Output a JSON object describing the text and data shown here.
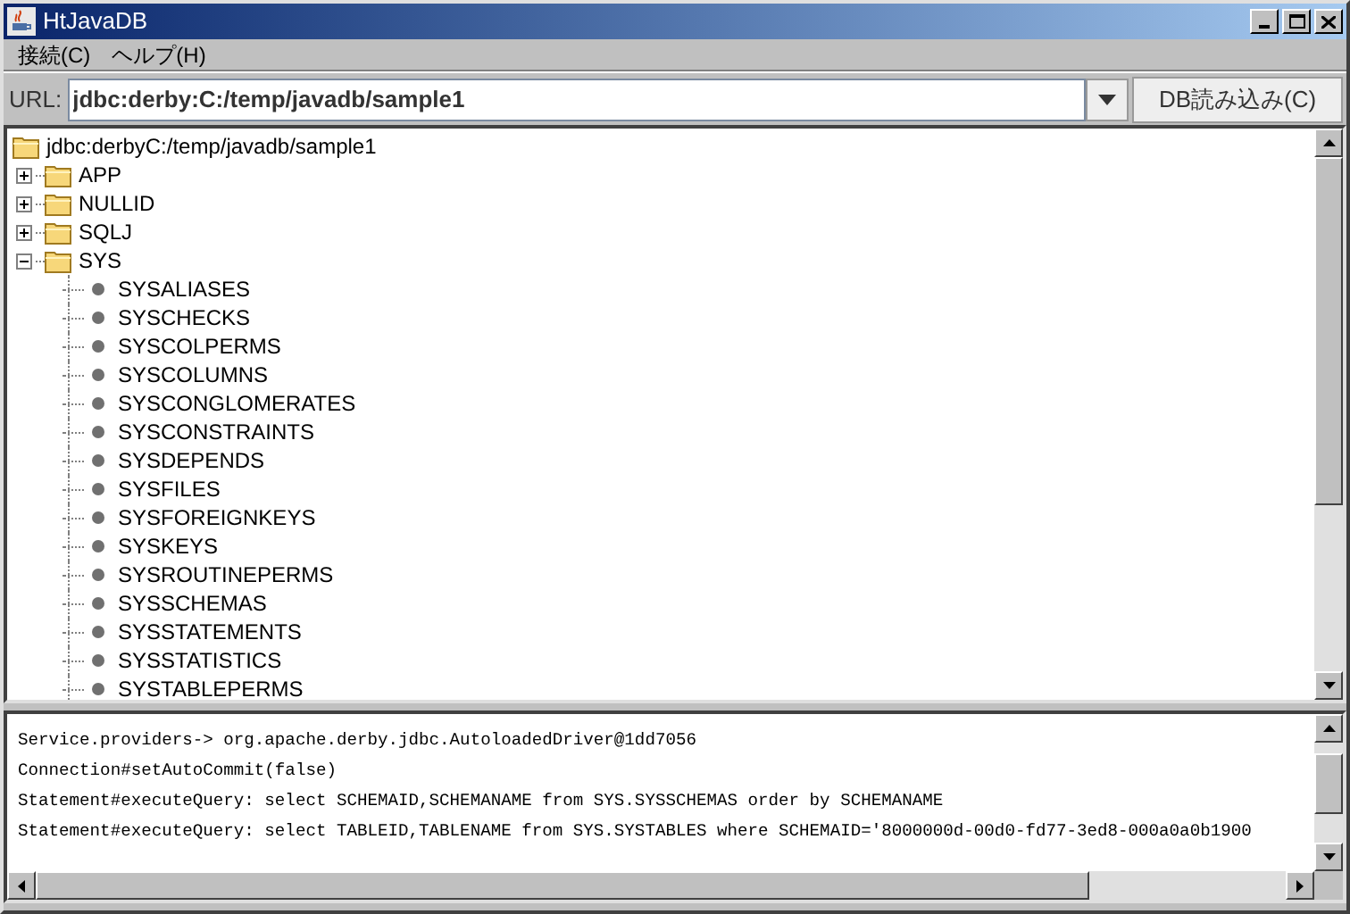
{
  "window": {
    "title": "HtJavaDB"
  },
  "menu": [
    {
      "label": "接続(C)"
    },
    {
      "label": "ヘルプ(H)"
    }
  ],
  "url_bar": {
    "label": "URL:",
    "value": "jdbc:derby:C:/temp/javadb/sample1",
    "button": "DB読み込み(C)"
  },
  "tree": {
    "root": "jdbc:derbyC:/temp/javadb/sample1",
    "children": [
      {
        "label": "APP",
        "kind": "folder",
        "expanded": false
      },
      {
        "label": "NULLID",
        "kind": "folder",
        "expanded": false
      },
      {
        "label": "SQLJ",
        "kind": "folder",
        "expanded": false
      },
      {
        "label": "SYS",
        "kind": "folder",
        "expanded": true,
        "children": [
          {
            "label": "SYSALIASES",
            "kind": "table"
          },
          {
            "label": "SYSCHECKS",
            "kind": "table"
          },
          {
            "label": "SYSCOLPERMS",
            "kind": "table"
          },
          {
            "label": "SYSCOLUMNS",
            "kind": "table"
          },
          {
            "label": "SYSCONGLOMERATES",
            "kind": "table"
          },
          {
            "label": "SYSCONSTRAINTS",
            "kind": "table"
          },
          {
            "label": "SYSDEPENDS",
            "kind": "table"
          },
          {
            "label": "SYSFILES",
            "kind": "table"
          },
          {
            "label": "SYSFOREIGNKEYS",
            "kind": "table"
          },
          {
            "label": "SYSKEYS",
            "kind": "table"
          },
          {
            "label": "SYSROUTINEPERMS",
            "kind": "table"
          },
          {
            "label": "SYSSCHEMAS",
            "kind": "table"
          },
          {
            "label": "SYSSTATEMENTS",
            "kind": "table"
          },
          {
            "label": "SYSSTATISTICS",
            "kind": "table"
          },
          {
            "label": "SYSTABLEPERMS",
            "kind": "table"
          }
        ]
      }
    ]
  },
  "log": [
    "Service.providers-> org.apache.derby.jdbc.AutoloadedDriver@1dd7056",
    "Connection#setAutoCommit(false)",
    "Statement#executeQuery: select SCHEMAID,SCHEMANAME from SYS.SYSSCHEMAS order by SCHEMANAME",
    "Statement#executeQuery: select TABLEID,TABLENAME from SYS.SYSTABLES where SCHEMAID='8000000d-00d0-fd77-3ed8-000a0a0b1900"
  ]
}
